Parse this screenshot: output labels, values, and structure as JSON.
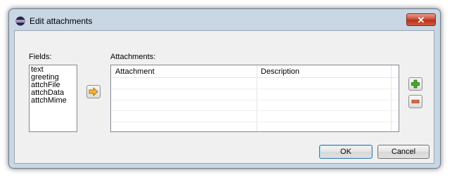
{
  "window": {
    "title": "Edit attachments",
    "close_glyph": "✕"
  },
  "fields": {
    "label": "Fields:",
    "items": [
      "text",
      "greeting",
      "attchFile",
      "attchData",
      "attchMime"
    ]
  },
  "attachments": {
    "label": "Attachments:",
    "columns": [
      "Attachment",
      "Description"
    ],
    "rows": []
  },
  "buttons": {
    "ok": "OK",
    "cancel": "Cancel"
  },
  "icons": {
    "app": "eclipse-app-icon",
    "transfer": "arrow-right-icon",
    "add": "plus-icon",
    "remove": "minus-icon"
  },
  "colors": {
    "arrow": "#f2b738",
    "add": "#4aa52c",
    "remove": "#e06a4a",
    "default_button_border": "#3c7fb1"
  }
}
